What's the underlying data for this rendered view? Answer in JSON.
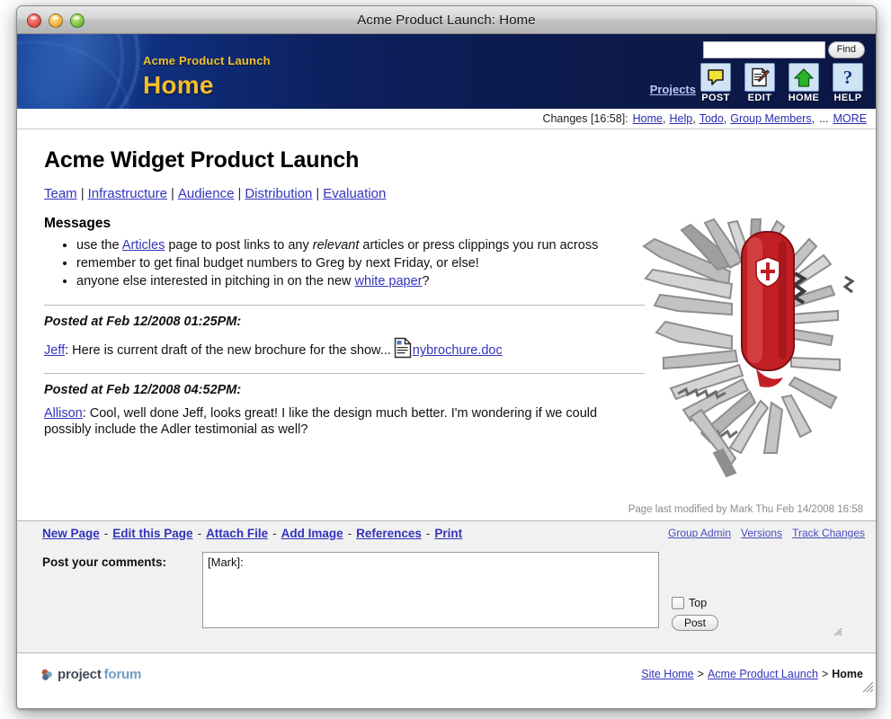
{
  "window": {
    "title": "Acme Product Launch: Home",
    "controls": [
      "close",
      "minimize",
      "zoom"
    ]
  },
  "banner": {
    "subtitle": "Acme Product Launch",
    "title": "Home",
    "projects_link": "Projects",
    "search": {
      "value": "",
      "placeholder": "",
      "button": "Find"
    },
    "tools": [
      {
        "label": "POST",
        "icon": "speech-bubble-icon"
      },
      {
        "label": "EDIT",
        "icon": "pencil-page-icon"
      },
      {
        "label": "HOME",
        "icon": "house-icon"
      },
      {
        "label": "HELP",
        "icon": "question-mark-icon"
      }
    ]
  },
  "changes": {
    "label": "Changes [16:58]:",
    "links": [
      "Home",
      "Help",
      "Todo",
      "Group Members"
    ],
    "ellipsis": "...",
    "more": "MORE"
  },
  "article": {
    "title": "Acme Widget Product Launch",
    "nav": [
      "Team",
      "Infrastructure",
      "Audience",
      "Distribution",
      "Evaluation"
    ],
    "section_heading": "Messages",
    "bullets": [
      {
        "parts": [
          {
            "t": "text",
            "v": "use the "
          },
          {
            "t": "link",
            "v": "Articles"
          },
          {
            "t": "text",
            "v": " page to post links to any "
          },
          {
            "t": "em",
            "v": "relevant"
          },
          {
            "t": "text",
            "v": " articles or press clippings you run across"
          }
        ]
      },
      {
        "parts": [
          {
            "t": "text",
            "v": "remember to get final budget numbers to Greg by next Friday, or else!"
          }
        ]
      },
      {
        "parts": [
          {
            "t": "text",
            "v": "anyone else interested in pitching in on the new "
          },
          {
            "t": "link",
            "v": "white paper"
          },
          {
            "t": "text",
            "v": "?"
          }
        ]
      }
    ],
    "posts": [
      {
        "timestamp": "Posted at Feb 12/2008 01:25PM:",
        "author": "Jeff",
        "body": ": Here is current draft of the new brochure for the show...",
        "attachment": "nybrochure.doc"
      },
      {
        "timestamp": "Posted at Feb 12/2008 04:52PM:",
        "author": "Allison",
        "body": ": Cool, well done Jeff, looks great! I like the design much better. I'm wondering if we could possibly include the Adler testimonial as well?",
        "attachment": ""
      }
    ],
    "last_modified": "Page last modified by Mark Thu Feb 14/2008 16:58",
    "image_alt": "swiss-army-knife"
  },
  "actions": {
    "left": [
      "New Page",
      "Edit this Page",
      "Attach File",
      "Add Image",
      "References",
      "Print"
    ],
    "separator": "-",
    "right": [
      "Group Admin",
      "Versions",
      "Track Changes"
    ]
  },
  "comment_form": {
    "label": "Post your comments:",
    "value": "[Mark]:",
    "placeholder": "",
    "checkbox_label": "Top",
    "checkbox_checked": false,
    "submit_label": "Post"
  },
  "footer": {
    "logo_first": "project",
    "logo_second": "forum",
    "breadcrumb": {
      "items": [
        "Site Home",
        "Acme Product Launch"
      ],
      "separator": ">",
      "current": "Home"
    }
  },
  "colors": {
    "banner_dark": "#0b1744",
    "banner_light": "#14409a",
    "banner_gold": "#f7bd2a",
    "link": "#3333bb",
    "chrome": "#f1f1f1"
  }
}
